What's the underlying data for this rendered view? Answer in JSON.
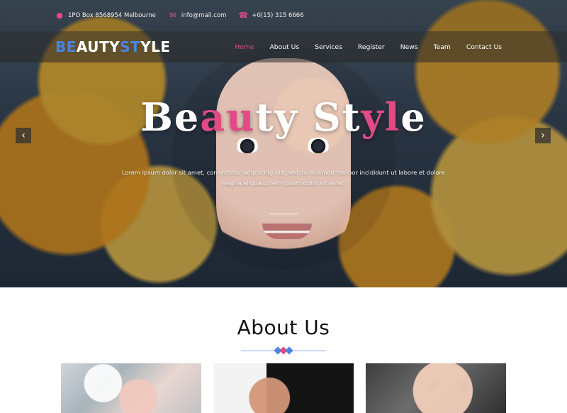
{
  "topbar": {
    "address": "1PO Box 8568954 Melbourne",
    "email": "info@mail.com",
    "phone": "+0(15) 315 6666",
    "icons": {
      "location": "location-icon",
      "email": "mail-icon",
      "phone": "phone-icon"
    }
  },
  "header": {
    "brand": {
      "accent_1": "BE",
      "normal_1": "AUTY ",
      "accent_2": "ST",
      "normal_2": "YLE"
    },
    "menu": [
      {
        "label": "Home",
        "active": true
      },
      {
        "label": "About Us",
        "active": false
      },
      {
        "label": "Services",
        "active": false
      },
      {
        "label": "Register",
        "active": false
      },
      {
        "label": "News",
        "active": false
      },
      {
        "label": "Team",
        "active": false
      },
      {
        "label": "Contact Us",
        "active": false
      }
    ]
  },
  "hero": {
    "title_parts": [
      {
        "text": "Be",
        "color": "white"
      },
      {
        "text": "au",
        "color": "pink"
      },
      {
        "text": "ty St",
        "color": "white"
      },
      {
        "text": "yl",
        "color": "pink"
      },
      {
        "text": "e",
        "color": "white"
      }
    ],
    "text": "Lorem ipsum dolor sit amet, consectetur adipiscing elit, sed do eiusmod tempor incididunt ut labore et dolore magna aliqua.Lorem ipsum dolor sit amet.",
    "prev_arrow": "chevron-left-icon",
    "next_arrow": "chevron-right-icon"
  },
  "about": {
    "title": "About Us",
    "cards": [
      {
        "id": "card-1"
      },
      {
        "id": "card-2"
      },
      {
        "id": "card-3"
      }
    ]
  },
  "colors": {
    "accent_blue": "#4a84e4",
    "accent_pink": "#e14a86"
  }
}
